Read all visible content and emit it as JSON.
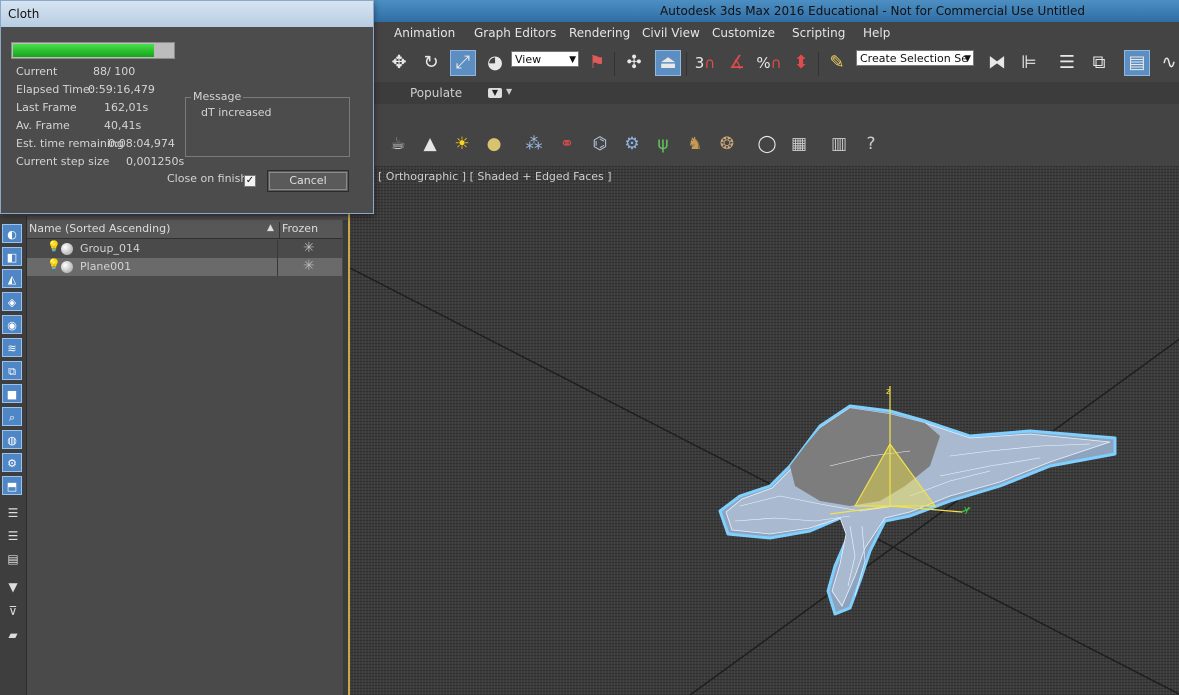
{
  "app": {
    "title": "Autodesk 3ds Max 2016 Educational - Not for Commercial Use   Untitled"
  },
  "menu": [
    "Animation",
    "Graph Editors",
    "Rendering",
    "Civil View",
    "Customize",
    "Scripting",
    "Help"
  ],
  "toolbar": {
    "reference_coord": "View",
    "selection_set_placeholder": "Create Selection Se",
    "snap_labels": [
      "3",
      "%"
    ]
  },
  "ribbon": {
    "populate_label": "Populate"
  },
  "viewport": {
    "label": "[ Orthographic ] [ Shaded + Edged Faces ]",
    "axis_labels": {
      "x": "x",
      "y": "y",
      "z": "z"
    }
  },
  "explorer": {
    "columns": {
      "name": "Name (Sorted Ascending)",
      "frozen": "Frozen"
    },
    "rows": [
      {
        "name": "Group_014",
        "selected": false
      },
      {
        "name": "Plane001",
        "selected": true
      }
    ]
  },
  "cloth_dialog": {
    "title": "Cloth",
    "progress": 0.88,
    "stats": [
      {
        "label": "Current",
        "value": "88/  100"
      },
      {
        "label": "Elapsed Time:",
        "value": "0:59:16,479"
      },
      {
        "label": "Last Frame",
        "value": "162,01s"
      },
      {
        "label": "Av. Frame",
        "value": "40,41s"
      },
      {
        "label": "Est. time remaining",
        "value": "0:08:04,974"
      },
      {
        "label": "Current step size",
        "value": "0,001250s"
      }
    ],
    "message_label": "Message",
    "message_text": "dT increased",
    "close_on_finish_label": "Close on finish",
    "close_on_finish_checked": true,
    "close_on_finish_mark": "✓",
    "cancel_label": "Cancel"
  },
  "colors": {
    "accent_active": "#5c8ec2",
    "progress_green": "#2cc231",
    "viewport_bg": "#3b3b3b",
    "selection_outline": "#7fd0ff",
    "gizmo_yellow": "#f2e24a"
  }
}
